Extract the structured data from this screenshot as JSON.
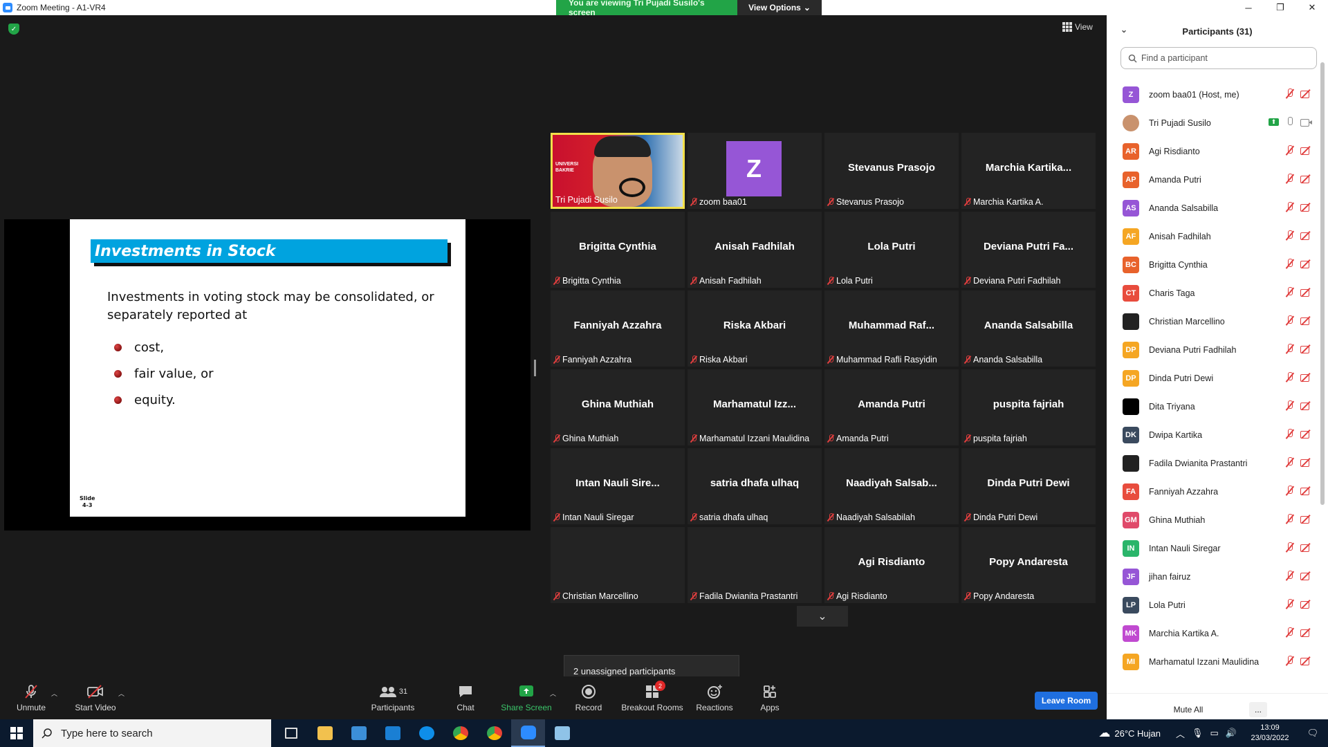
{
  "window": {
    "title": "Zoom Meeting - A1-VR4",
    "minimize": "─",
    "maximize": "❐",
    "close": "✕"
  },
  "share_banner": {
    "viewing": "You are viewing Tri Pujadi Susilo's screen",
    "options": "View Options"
  },
  "view_button": "View",
  "slide": {
    "title": "Investments in Stock",
    "lead": "Investments in voting stock may be consolidated, or separately reported at",
    "bullets": [
      "cost,",
      "fair value, or",
      "equity."
    ],
    "slide_no_1": "Slide",
    "slide_no_2": "4-3"
  },
  "tiles": [
    {
      "big": "",
      "label": "Tri Pujadi Susilo",
      "type": "video",
      "muted": false,
      "active": true
    },
    {
      "big": "Z",
      "label": "zoom baa01",
      "type": "avatar",
      "muted": true
    },
    {
      "big": "Stevanus Prasojo",
      "label": "Stevanus Prasojo",
      "muted": true
    },
    {
      "big": "Marchia  Kartika...",
      "label": "Marchia Kartika A.",
      "muted": true
    },
    {
      "big": "Brigitta Cynthia",
      "label": "Brigitta Cynthia",
      "muted": true
    },
    {
      "big": "Anisah Fadhilah",
      "label": "Anisah Fadhilah",
      "muted": true
    },
    {
      "big": "Lola Putri",
      "label": "Lola Putri",
      "muted": true
    },
    {
      "big": "Deviana  Putri  Fa...",
      "label": "Deviana Putri Fadhilah",
      "muted": true
    },
    {
      "big": "Fanniyah Azzahra",
      "label": "Fanniyah Azzahra",
      "muted": true
    },
    {
      "big": "Riska Akbari",
      "label": "Riska Akbari",
      "muted": true
    },
    {
      "big": "Muhammad  Raf...",
      "label": "Muhammad Rafli Rasyidin",
      "muted": true
    },
    {
      "big": "Ananda Salsabilla",
      "label": "Ananda Salsabilla",
      "muted": true
    },
    {
      "big": "Ghina Muthiah",
      "label": "Ghina Muthiah",
      "muted": true
    },
    {
      "big": "Marhamatul  Izz...",
      "label": "Marhamatul Izzani Maulidina",
      "muted": true
    },
    {
      "big": "Amanda Putri",
      "label": "Amanda Putri",
      "muted": true
    },
    {
      "big": "puspita fajriah",
      "label": "puspita fajriah",
      "muted": true
    },
    {
      "big": "Intan  Nauli  Sire...",
      "label": "Intan Nauli Siregar",
      "muted": true
    },
    {
      "big": "satria dhafa ulhaq",
      "label": "satria dhafa ulhaq",
      "muted": true
    },
    {
      "big": "Naadiyah  Salsab...",
      "label": "Naadiyah Salsabilah",
      "muted": true
    },
    {
      "big": "Dinda Putri Dewi",
      "label": "Dinda Putri Dewi",
      "muted": true
    },
    {
      "big": "",
      "label": "Christian Marcellino",
      "muted": true
    },
    {
      "big": "",
      "label": "Fadila Dwianita Prastantri",
      "muted": true
    },
    {
      "big": "Agi Risdianto",
      "label": "Agi Risdianto",
      "muted": true
    },
    {
      "big": "Popy Andaresta",
      "label": "Popy Andaresta",
      "muted": true
    }
  ],
  "unassigned": "2 unassigned participants",
  "toolbar": {
    "unmute": "Unmute",
    "start_video": "Start Video",
    "participants": "Participants",
    "participants_count": "31",
    "chat": "Chat",
    "share_screen": "Share Screen",
    "record": "Record",
    "breakout_rooms": "Breakout Rooms",
    "breakout_badge": "2",
    "reactions": "Reactions",
    "apps": "Apps",
    "leave_room": "Leave Room"
  },
  "panel": {
    "title": "Participants (31)",
    "search_placeholder": "Find a participant",
    "mute_all": "Mute All",
    "more": "...",
    "participants": [
      {
        "initials": "Z",
        "name": "zoom baa01 (Host, me)",
        "color": "#9656d6"
      },
      {
        "initials": "",
        "name": "Tri Pujadi Susilo",
        "color": "#c9926d",
        "photo": true,
        "live": true
      },
      {
        "initials": "AR",
        "name": "Agi Risdianto",
        "color": "#e8622b"
      },
      {
        "initials": "AP",
        "name": "Amanda Putri",
        "color": "#e8622b"
      },
      {
        "initials": "AS",
        "name": "Ananda Salsabilla",
        "color": "#9656d6"
      },
      {
        "initials": "AF",
        "name": "Anisah Fadhilah",
        "color": "#f5a623"
      },
      {
        "initials": "BC",
        "name": "Brigitta Cynthia",
        "color": "#e8622b"
      },
      {
        "initials": "CT",
        "name": "Charis Taga",
        "color": "#e84c3d"
      },
      {
        "initials": "",
        "name": "Christian Marcellino",
        "color": "#222222"
      },
      {
        "initials": "DP",
        "name": "Deviana Putri Fadhilah",
        "color": "#f5a623"
      },
      {
        "initials": "DP",
        "name": "Dinda Putri Dewi",
        "color": "#f5a623"
      },
      {
        "initials": "",
        "name": "Dita Triyana",
        "color": "#000000"
      },
      {
        "initials": "DK",
        "name": "Dwipa Kartika",
        "color": "#3a4a5e"
      },
      {
        "initials": "",
        "name": "Fadila Dwianita Prastantri",
        "color": "#222222"
      },
      {
        "initials": "FA",
        "name": "Fanniyah Azzahra",
        "color": "#e84c3d"
      },
      {
        "initials": "GM",
        "name": "Ghina Muthiah",
        "color": "#e04a6a"
      },
      {
        "initials": "IN",
        "name": "Intan Nauli Siregar",
        "color": "#2ab56a"
      },
      {
        "initials": "JF",
        "name": "jihan fairuz",
        "color": "#9656d6"
      },
      {
        "initials": "LP",
        "name": "Lola Putri",
        "color": "#3a4a5e"
      },
      {
        "initials": "MK",
        "name": "Marchia Kartika A.",
        "color": "#c04ad0"
      },
      {
        "initials": "MI",
        "name": "Marhamatul Izzani Maulidina",
        "color": "#f5a623"
      }
    ]
  },
  "taskbar": {
    "search_placeholder": "Type here to search",
    "weather": "26°C  Hujan",
    "time": "13:09",
    "date": "23/03/2022"
  }
}
